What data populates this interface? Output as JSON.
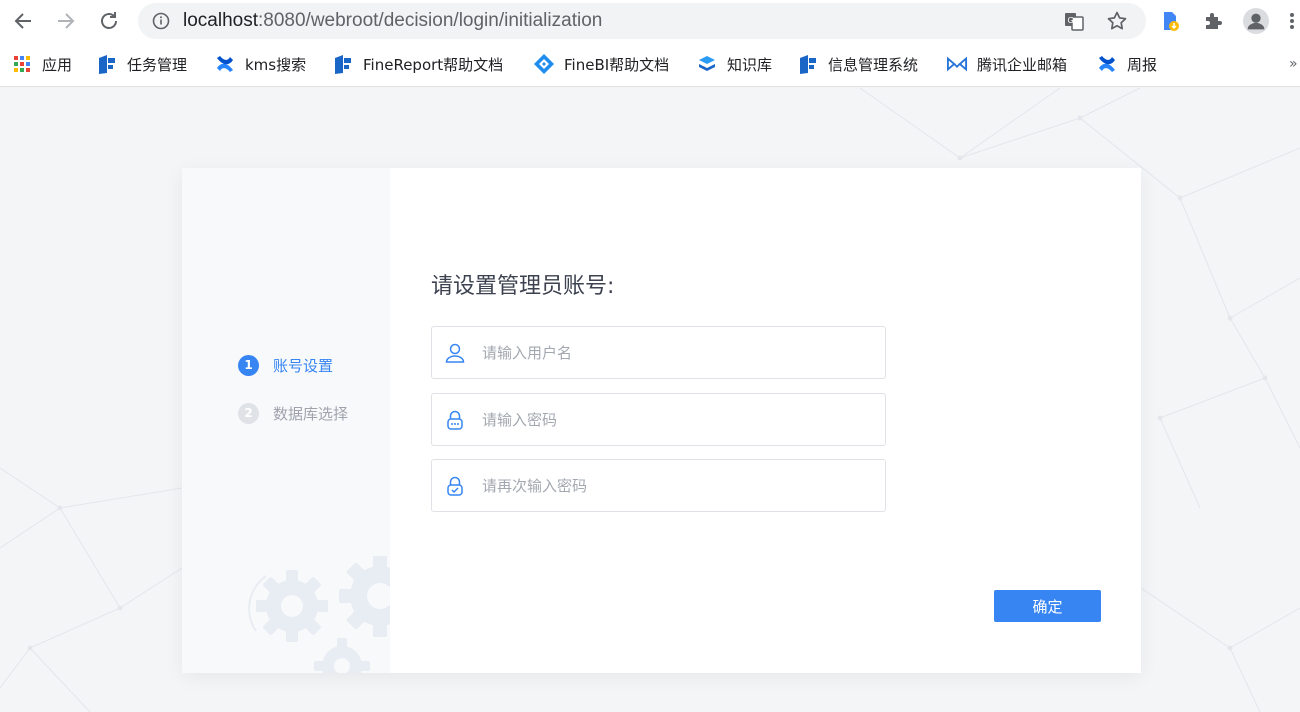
{
  "browser": {
    "url_host": "localhost",
    "url_rest": ":8080/webroot/decision/login/initialization"
  },
  "bookmarks": [
    {
      "label": "应用",
      "icon": "apps-grid-icon"
    },
    {
      "label": "任务管理",
      "icon": "finereport-icon"
    },
    {
      "label": "kms搜索",
      "icon": "confluence-icon"
    },
    {
      "label": "FineReport帮助文档",
      "icon": "finereport-icon"
    },
    {
      "label": "FineBI帮助文档",
      "icon": "finebi-icon"
    },
    {
      "label": "知识库",
      "icon": "layers-icon"
    },
    {
      "label": "信息管理系统",
      "icon": "finereport-icon"
    },
    {
      "label": "腾讯企业邮箱",
      "icon": "tencent-mail-icon"
    },
    {
      "label": "周报",
      "icon": "confluence-icon"
    }
  ],
  "bookmarks_more": "»",
  "steps": [
    {
      "num": "1",
      "label": "账号设置",
      "state": "active"
    },
    {
      "num": "2",
      "label": "数据库选择",
      "state": "inactive"
    }
  ],
  "form": {
    "title": "请设置管理员账号:",
    "username_placeholder": "请输入用户名",
    "password_placeholder": "请输入密码",
    "confirm_password_placeholder": "请再次输入密码",
    "submit_label": "确定"
  },
  "colors": {
    "accent": "#3685f2",
    "inactive_step": "#dfe2e7"
  }
}
